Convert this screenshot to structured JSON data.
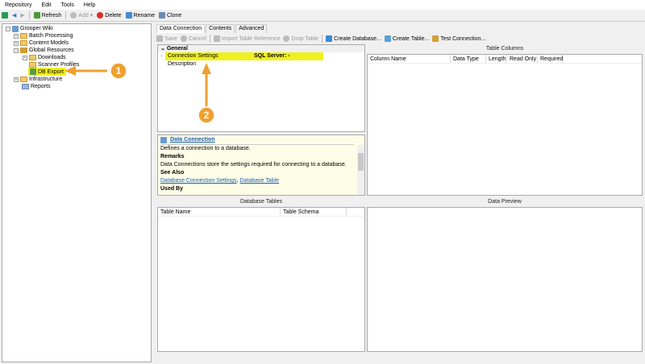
{
  "menu": [
    "Repository",
    "Edit",
    "Tools",
    "Help"
  ],
  "toolbar": {
    "refresh": "Refresh",
    "add": "Add",
    "delete": "Delete",
    "rename": "Rename",
    "clone": "Clone"
  },
  "tree": {
    "root": "Grooper Wiki",
    "items": [
      "Batch Processing",
      "Content Models",
      "Global Resources",
      "Downloads",
      "Scanner Profiles",
      "DB Export",
      "Infrastructure",
      "Reports"
    ]
  },
  "tabs": [
    "Data Connection",
    "Contents",
    "Advanced"
  ],
  "editor_toolbar": {
    "save": "Save",
    "cancel": "Cancel",
    "import": "Import Table Reference",
    "drop": "Drop Table",
    "create_db": "Create Database...",
    "create_table": "Create Table...",
    "test": "Test Connection..."
  },
  "properties": {
    "category": "General",
    "rows": [
      {
        "name": "Connection Settings",
        "value": "SQL Server: -"
      },
      {
        "name": "Description",
        "value": ""
      }
    ]
  },
  "help": {
    "title": "Data Connection",
    "desc": "Defines a connection to a database.",
    "remarks_h": "Remarks",
    "remarks": "Data Connections store the settings required for connecting to a database.",
    "see_also_h": "See Also",
    "link1": "Database Connection Settings",
    "link2": "Database Table",
    "used_by_h": "Used By"
  },
  "db_tables": {
    "title": "Database Tables",
    "columns": [
      "Table Name",
      "Table Schema"
    ]
  },
  "table_columns": {
    "title": "Table Columns",
    "columns": [
      "Column Name",
      "Data Type",
      "Length",
      "Read Only",
      "Required"
    ]
  },
  "data_preview": {
    "title": "Data Preview"
  },
  "annotations": [
    "1",
    "2"
  ],
  "colors": {
    "highlight": "#f0f020",
    "annotation": "#f0a030"
  }
}
